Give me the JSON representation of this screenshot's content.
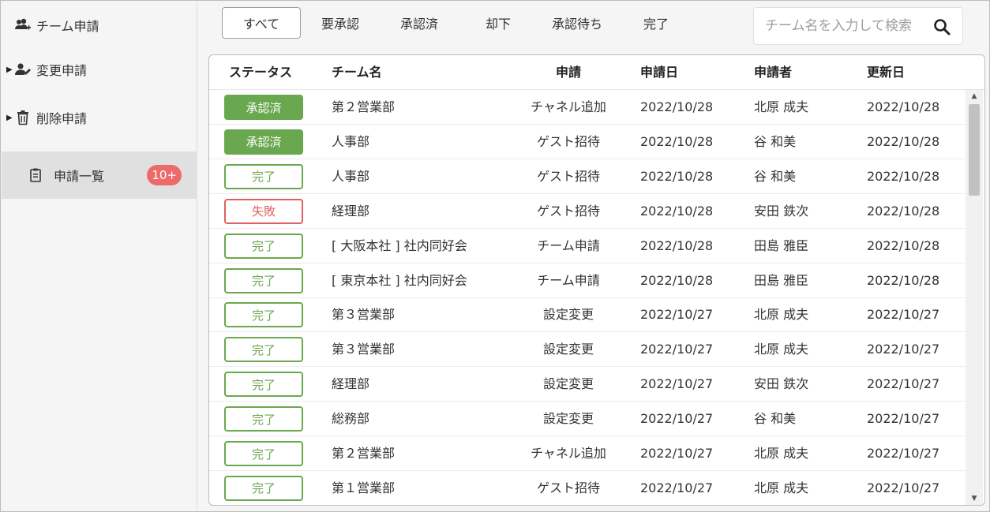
{
  "sidebar": {
    "items": [
      {
        "label": "チーム申請",
        "icon": "users-plus-icon",
        "caret": false
      },
      {
        "label": "変更申請",
        "icon": "user-edit-icon",
        "caret": true
      },
      {
        "label": "削除申請",
        "icon": "trash-icon",
        "caret": true
      },
      {
        "label": "申請一覧",
        "icon": "clipboard-icon",
        "caret": false,
        "active": true,
        "badge": "10+"
      }
    ]
  },
  "tabs": [
    "すべて",
    "要承認",
    "承認済",
    "却下",
    "承認待ち",
    "完了"
  ],
  "active_tab": "すべて",
  "search": {
    "placeholder": "チーム名を入力して検索",
    "value": ""
  },
  "table": {
    "headers": {
      "status": "ステータス",
      "team": "チーム名",
      "request": "申請",
      "date": "申請日",
      "applicant": "申請者",
      "updated": "更新日"
    },
    "rows": [
      {
        "status": "承認済",
        "status_kind": "approved",
        "team": "第２営業部",
        "request": "チャネル追加",
        "date": "2022/10/28",
        "applicant": "北原 成夫",
        "updated": "2022/10/28"
      },
      {
        "status": "承認済",
        "status_kind": "approved",
        "team": "人事部",
        "request": "ゲスト招待",
        "date": "2022/10/28",
        "applicant": "谷 和美",
        "updated": "2022/10/28"
      },
      {
        "status": "完了",
        "status_kind": "done",
        "team": "人事部",
        "request": "ゲスト招待",
        "date": "2022/10/28",
        "applicant": "谷 和美",
        "updated": "2022/10/28"
      },
      {
        "status": "失敗",
        "status_kind": "failed",
        "team": "経理部",
        "request": "ゲスト招待",
        "date": "2022/10/28",
        "applicant": "安田 鉄次",
        "updated": "2022/10/28"
      },
      {
        "status": "完了",
        "status_kind": "done",
        "team": "[ 大阪本社 ] 社内同好会",
        "request": "チーム申請",
        "date": "2022/10/28",
        "applicant": "田島 雅臣",
        "updated": "2022/10/28"
      },
      {
        "status": "完了",
        "status_kind": "done",
        "team": "[ 東京本社 ] 社内同好会",
        "request": "チーム申請",
        "date": "2022/10/28",
        "applicant": "田島 雅臣",
        "updated": "2022/10/28"
      },
      {
        "status": "完了",
        "status_kind": "done",
        "team": "第３営業部",
        "request": "設定変更",
        "date": "2022/10/27",
        "applicant": "北原 成夫",
        "updated": "2022/10/27"
      },
      {
        "status": "完了",
        "status_kind": "done",
        "team": "第３営業部",
        "request": "設定変更",
        "date": "2022/10/27",
        "applicant": "北原 成夫",
        "updated": "2022/10/27"
      },
      {
        "status": "完了",
        "status_kind": "done",
        "team": "経理部",
        "request": "設定変更",
        "date": "2022/10/27",
        "applicant": "安田 鉄次",
        "updated": "2022/10/27"
      },
      {
        "status": "完了",
        "status_kind": "done",
        "team": "総務部",
        "request": "設定変更",
        "date": "2022/10/27",
        "applicant": "谷 和美",
        "updated": "2022/10/27"
      },
      {
        "status": "完了",
        "status_kind": "done",
        "team": "第２営業部",
        "request": "チャネル追加",
        "date": "2022/10/27",
        "applicant": "北原 成夫",
        "updated": "2022/10/27"
      },
      {
        "status": "完了",
        "status_kind": "done",
        "team": "第１営業部",
        "request": "ゲスト招待",
        "date": "2022/10/27",
        "applicant": "北原 成夫",
        "updated": "2022/10/27"
      }
    ]
  },
  "colors": {
    "approved": "#6aa84f",
    "failed": "#e06060",
    "badge": "#ee6a6a"
  }
}
